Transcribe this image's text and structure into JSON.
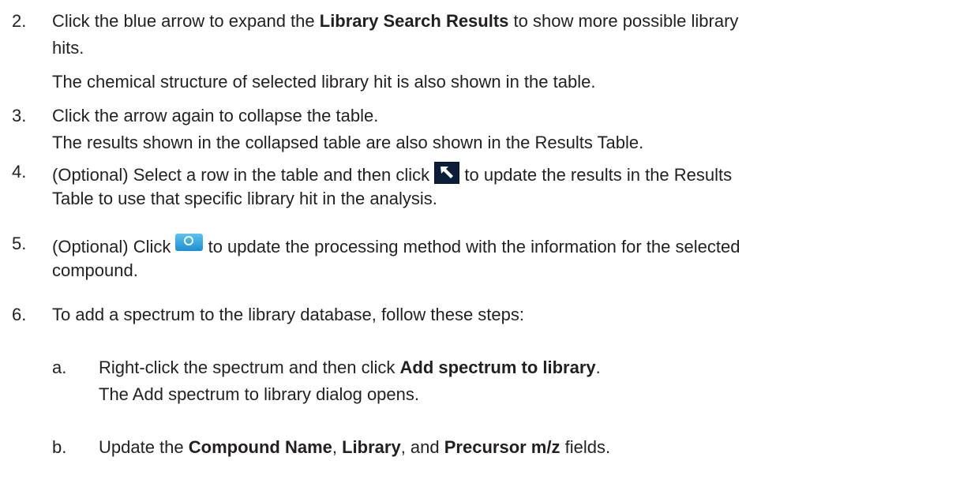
{
  "steps": [
    {
      "number": "2.",
      "line1_a": "Click the blue arrow to expand the ",
      "line1_bold": "Library Search Results",
      "line1_b": " to show more possible library",
      "line2": "hits.",
      "note": "The chemical structure of selected library hit is also shown in the table."
    },
    {
      "number": "3.",
      "line1": "Click the arrow again to collapse the table.",
      "line2": "The results shown in the collapsed table are also shown in the Results Table."
    },
    {
      "number": "4.",
      "line1_a": "(Optional) Select a row in the table and then click ",
      "icon": "select-hit-arrow-icon",
      "line1_b": " to update the results in the Results",
      "line2": "Table to use that specific library hit in the analysis."
    },
    {
      "number": "5.",
      "line1_a": "(Optional) Click ",
      "icon": "update-method-icon",
      "line1_b": " to update the processing method with the information for the selected",
      "line2": "compound."
    },
    {
      "number": "6.",
      "line1": "To add a spectrum to the library database, follow these steps:"
    }
  ],
  "substeps": [
    {
      "letter": "a.",
      "line1_a": "Right-click the spectrum and then click ",
      "line1_bold": "Add spectrum to library",
      "line1_b": ".",
      "line2": "The Add spectrum to library dialog opens."
    },
    {
      "letter": "b.",
      "line1_a": "Update the ",
      "bold1": "Compound Name",
      "sep1": ", ",
      "bold2": "Library",
      "sep2": ", and ",
      "bold3": "Precursor m/z",
      "tail": " fields."
    }
  ],
  "colors": {
    "text": "#231f20",
    "icon_dark": "#0b1f3a",
    "icon_blue": "#1a8fd1"
  }
}
